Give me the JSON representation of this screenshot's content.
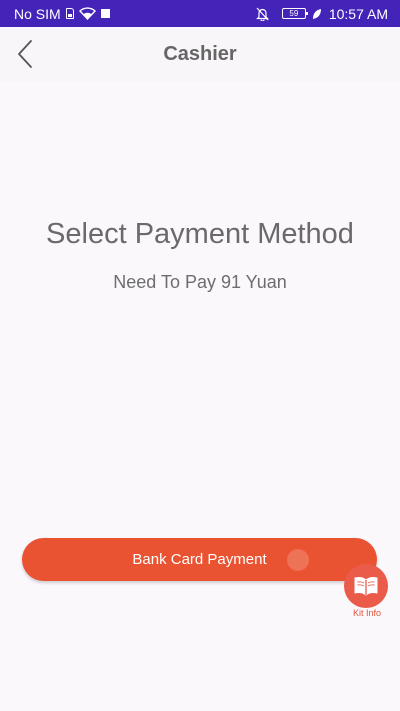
{
  "status_bar": {
    "carrier": "No SIM",
    "battery": "59",
    "time": "10:57 AM"
  },
  "header": {
    "title": "Cashier"
  },
  "main": {
    "title": "Select Payment Method",
    "subtitle": "Need To Pay 91 Yuan"
  },
  "payment_button": {
    "label": "Bank Card Payment"
  },
  "kit_info": {
    "label": "Kit Info"
  },
  "colors": {
    "status_bar": "#4423b8",
    "accent": "#ea5331",
    "background": "#fbf8fc"
  }
}
